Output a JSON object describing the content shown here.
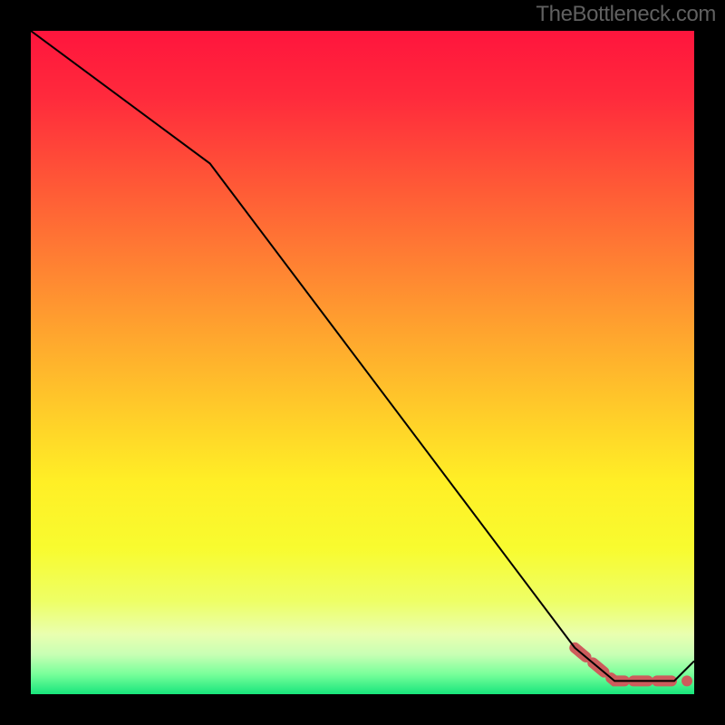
{
  "attribution": "TheBottleneck.com",
  "chart_data": {
    "type": "line",
    "title": "",
    "xlabel": "",
    "ylabel": "",
    "xlim": [
      0,
      100
    ],
    "ylim": [
      0,
      100
    ],
    "series": [
      {
        "name": "main-curve",
        "x": [
          0,
          27,
          82,
          88,
          97,
          100
        ],
        "values": [
          100,
          80,
          7,
          2,
          2,
          5
        ]
      },
      {
        "name": "highlight-segment",
        "x": [
          82,
          88,
          97
        ],
        "values": [
          7,
          2,
          2
        ]
      }
    ],
    "background_gradient_stops": [
      {
        "offset": 0.0,
        "color": "#ff153d"
      },
      {
        "offset": 0.1,
        "color": "#ff2a3c"
      },
      {
        "offset": 0.22,
        "color": "#ff5437"
      },
      {
        "offset": 0.34,
        "color": "#ff7d33"
      },
      {
        "offset": 0.46,
        "color": "#ffa62e"
      },
      {
        "offset": 0.58,
        "color": "#ffce29"
      },
      {
        "offset": 0.68,
        "color": "#ffef26"
      },
      {
        "offset": 0.78,
        "color": "#f8fb2f"
      },
      {
        "offset": 0.86,
        "color": "#eeff66"
      },
      {
        "offset": 0.91,
        "color": "#e9ffb0"
      },
      {
        "offset": 0.94,
        "color": "#c8ffb4"
      },
      {
        "offset": 0.97,
        "color": "#78ff9a"
      },
      {
        "offset": 1.0,
        "color": "#18e57c"
      }
    ],
    "highlight_style": {
      "color": "#cd5c5c",
      "stroke_width": 12,
      "end_dot_radius": 6
    },
    "curve_style": {
      "color": "#000000",
      "stroke_width": 2
    }
  }
}
